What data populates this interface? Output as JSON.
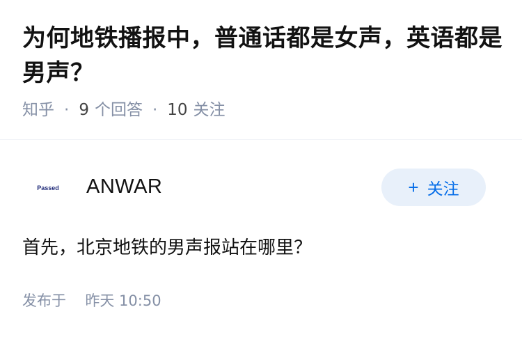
{
  "question": {
    "title": "为何地铁播报中，普通话都是女声，英语都是男声？",
    "source": "知乎",
    "answer_count": "9",
    "answer_label": "个回答",
    "follower_count": "10",
    "follower_label": "关注"
  },
  "author": {
    "avatar_text": "Passed",
    "name": "ANWAR",
    "follow_icon": "plus-icon",
    "follow_symbol": "+",
    "follow_label": "关注"
  },
  "answer": {
    "content": "首先，北京地铁的男声报站在哪里？",
    "published_label": "发布于",
    "published_time": "昨天 10:50"
  },
  "colors": {
    "text": "#121212",
    "meta": "#8590a6",
    "accent": "#056de8",
    "button_bg": "#e8f0fa"
  }
}
